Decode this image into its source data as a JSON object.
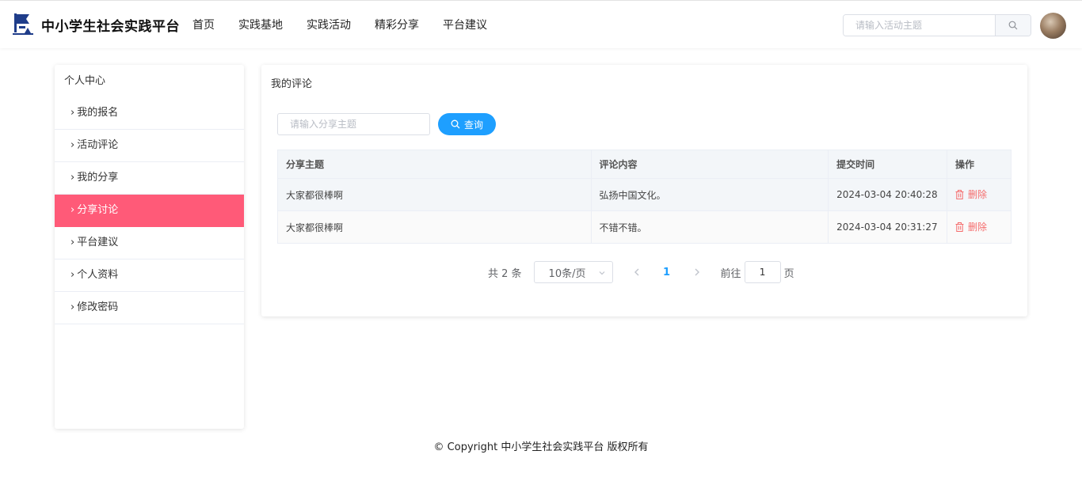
{
  "header": {
    "brand": "中小学生社会实践平台",
    "nav": [
      "首页",
      "实践基地",
      "实践活动",
      "精彩分享",
      "平台建议"
    ],
    "search_placeholder": "请输入活动主题"
  },
  "sidebar": {
    "title": "个人中心",
    "items": [
      "我的报名",
      "活动评论",
      "我的分享",
      "分享讨论",
      "平台建议",
      "个人资料",
      "修改密码"
    ],
    "active_index": 3
  },
  "main": {
    "title": "我的评论",
    "query_placeholder": "请输入分享主题",
    "query_button": "查询",
    "table": {
      "headers": [
        "分享主题",
        "评论内容",
        "提交时间",
        "操作"
      ],
      "rows": [
        {
          "topic": "大家都很棒啊",
          "content": "弘扬中国文化。",
          "time": "2024-03-04 20:40:28",
          "action": "删除"
        },
        {
          "topic": "大家都很棒啊",
          "content": "不错不错。",
          "time": "2024-03-04 20:31:27",
          "action": "删除"
        }
      ]
    },
    "pagination": {
      "total": "共 2 条",
      "page_size": "10条/页",
      "current_page": "1",
      "goto_label": "前往",
      "goto_value": "1",
      "page_unit": "页"
    }
  },
  "footer": {
    "copyright": "© Copyright 中小学生社会实践平台 版权所有"
  },
  "colors": {
    "accent": "#1e9fff",
    "active_item": "#ff5a78",
    "danger": "#f56c6c"
  }
}
